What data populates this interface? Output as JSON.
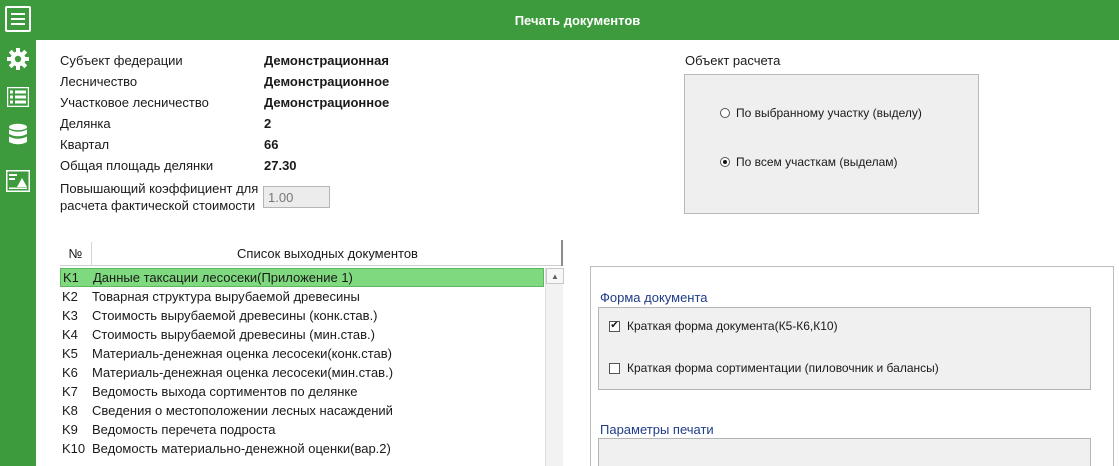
{
  "header": {
    "title": "Печать документов"
  },
  "sidebar": {
    "colors": {
      "bg": "#3d9b3d",
      "icon": "#ffffff"
    },
    "icons": [
      "hamburger-menu-icon",
      "gear-icon",
      "list-icon",
      "database-icon",
      "report-icon"
    ]
  },
  "info": {
    "subject_label": "Субъект федерации",
    "subject_value": "Демонстрационная",
    "forestry_label": "Лесничество",
    "forestry_value": "Демонстрационное",
    "district_label": "Участковое лесничество",
    "district_value": "Демонстрационное",
    "plot_label": "Делянка",
    "plot_value": "2",
    "quarter_label": "Квартал",
    "quarter_value": "66",
    "area_label": "Общая площадь делянки",
    "area_value": "27.30",
    "coef_label_line1": "Повышающий коэффициент для",
    "coef_label_line2": "расчета фактической стоимости",
    "coef_value": "1.00"
  },
  "calc_object": {
    "title": "Объект расчета",
    "options": [
      {
        "label": "По выбранному участку (выделу)",
        "selected": false
      },
      {
        "label": "По всем участкам (выделам)",
        "selected": true
      }
    ]
  },
  "documents": {
    "col_num": "№",
    "col_title": "Список выходных документов",
    "selected_color": "#7fd97f",
    "rows": [
      {
        "code": "K1",
        "name": "Данные таксации лесосеки(Приложение 1)",
        "selected": true
      },
      {
        "code": "K2",
        "name": "Товарная структура вырубаемой древесины",
        "selected": false
      },
      {
        "code": "K3",
        "name": "Стоимость вырубаемой древесины (конк.став.)",
        "selected": false
      },
      {
        "code": "K4",
        "name": "Стоимость вырубаемой древесины (мин.став.)",
        "selected": false
      },
      {
        "code": "K5",
        "name": "Материаль-денежная оценка лесосеки(конк.став)",
        "selected": false
      },
      {
        "code": "K6",
        "name": "Материаль-денежная оценка лесосеки(мин.став.)",
        "selected": false
      },
      {
        "code": "K7",
        "name": "Ведомость выхода сортиментов по делянке",
        "selected": false
      },
      {
        "code": "K8",
        "name": "Сведения о местоположении лесных насаждений",
        "selected": false
      },
      {
        "code": "K9",
        "name": "Ведомость перечета подроста",
        "selected": false
      },
      {
        "code": "K10",
        "name": "Ведомость материально-денежной оценки(вар.2)",
        "selected": false
      }
    ]
  },
  "doc_form": {
    "title": "Форма документа",
    "options": [
      {
        "label": "Краткая форма документа(К5-К6,К10)",
        "checked": true
      },
      {
        "label": "Краткая форма сортиментации (пиловочник и балансы)",
        "checked": false
      }
    ]
  },
  "print_params": {
    "title": "Параметры печати"
  }
}
